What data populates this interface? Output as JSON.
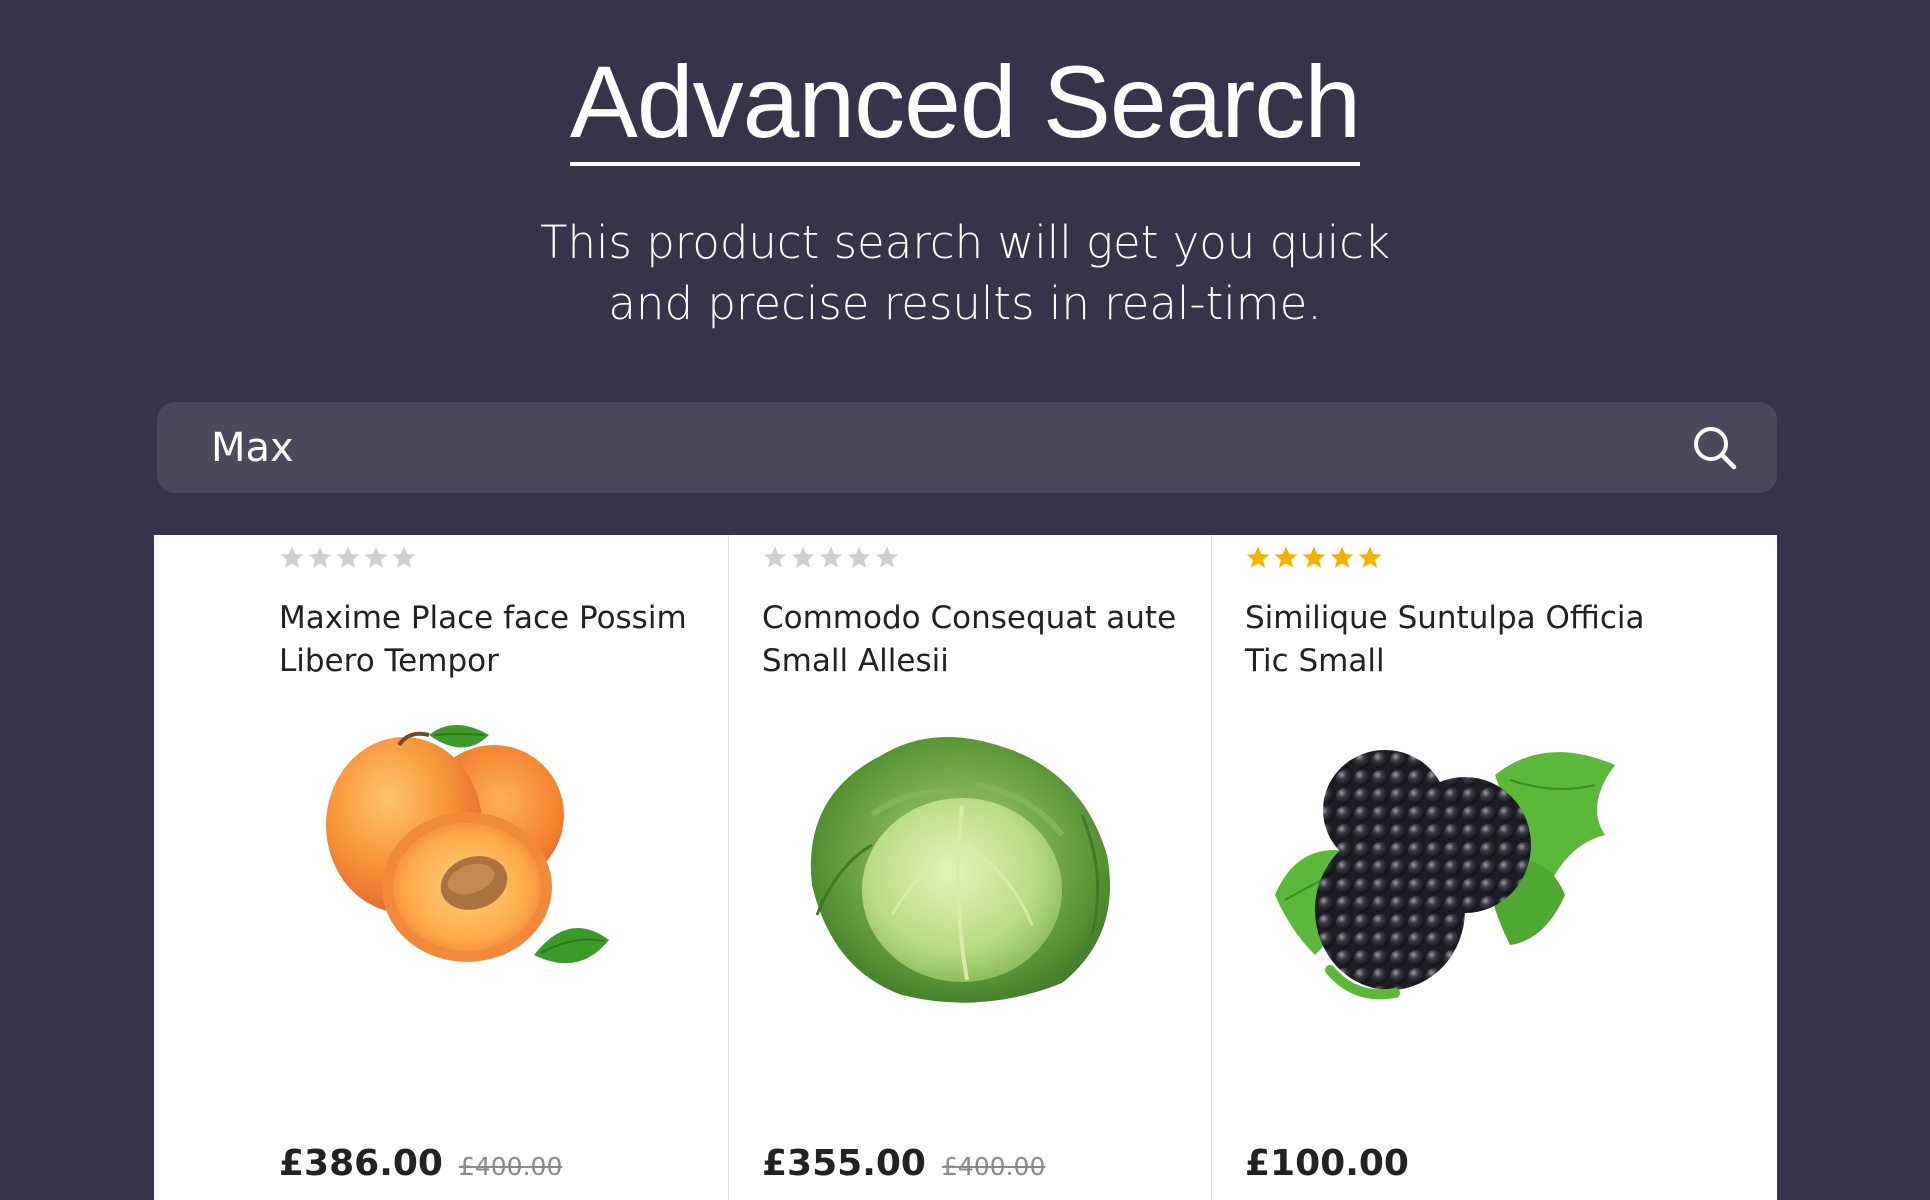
{
  "header": {
    "title": "Advanced Search",
    "subtitle_line1": "This product search will get you quick",
    "subtitle_line2": "and precise results in real-time."
  },
  "search": {
    "value": "Max",
    "placeholder": "",
    "icon": "search-icon"
  },
  "colors": {
    "background": "#36344a",
    "search_bg": "#4a485c",
    "star_filled": "#f5b301",
    "star_empty": "#cfcfcf"
  },
  "products": [
    {
      "name": "Maxime Place face Possim Libero Tempor",
      "rating": 0,
      "max_rating": 5,
      "price": "£386.00",
      "old_price": "£400.00",
      "image": "apricot"
    },
    {
      "name": "Commodo Consequat aute Small Allesii",
      "rating": 0,
      "max_rating": 5,
      "price": "£355.00",
      "old_price": "£400.00",
      "image": "cabbage"
    },
    {
      "name": "Similique Suntulpa Officia Tic Small",
      "rating": 5,
      "max_rating": 5,
      "price": "£100.00",
      "old_price": "",
      "image": "blackberries"
    }
  ]
}
